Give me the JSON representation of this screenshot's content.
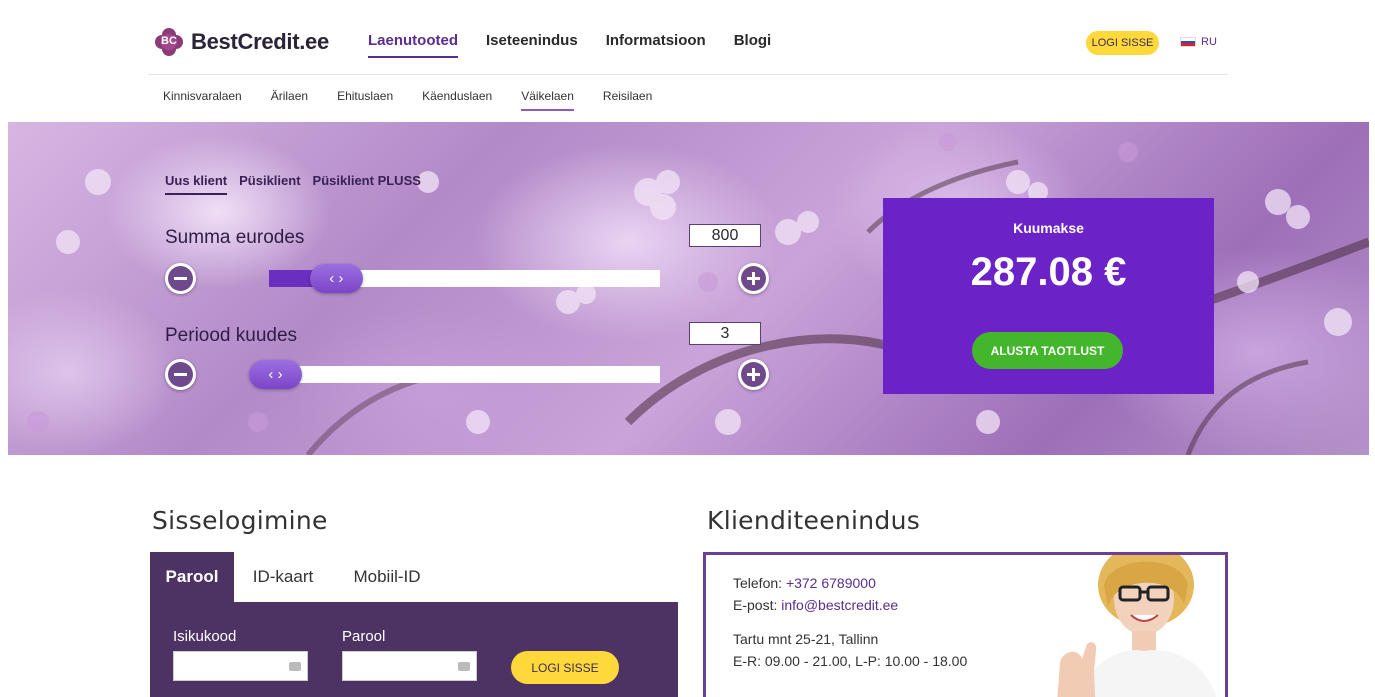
{
  "header": {
    "logo_mark": "BC",
    "logo_text": "BestCredit.ee",
    "nav": [
      "Laenutooted",
      "Iseteenindus",
      "Informatsioon",
      "Blogi"
    ],
    "nav_active": "Laenutooted",
    "login_label": "LOGI SISSE",
    "lang_label": "RU"
  },
  "subnav": {
    "items": [
      "Kinnisvaralaen",
      "Ärilaen",
      "Ehituslaen",
      "Käenduslaen",
      "Väikelaen",
      "Reisilaen"
    ],
    "active": "Väikelaen"
  },
  "calculator": {
    "client_tabs": [
      "Uus klient",
      "Püsiklient",
      "Püsiklient PLUSS"
    ],
    "active_tab": "Uus klient",
    "amount_label": "Summa eurodes",
    "amount_value": "800",
    "amount_fraction": 0.11,
    "period_label": "Periood kuudes",
    "period_value": "3",
    "period_fraction": 0.0,
    "handle_glyph": "‹ ›"
  },
  "payment": {
    "title": "Kuumakse",
    "amount": "287.08 €",
    "apply_label": "ALUSTA TAOTLUST"
  },
  "login": {
    "title": "Sisselogimine",
    "tabs": [
      "Parool",
      "ID-kaart",
      "Mobiil-ID"
    ],
    "active_tab": "Parool",
    "id_label": "Isikukood",
    "id_value": "",
    "password_label": "Parool",
    "password_value": "",
    "submit_label": "LOGI SISSE"
  },
  "support": {
    "title": "Klienditeenindus",
    "phone_label": "Telefon: ",
    "phone": "+372 6789000",
    "email_label": "E-post: ",
    "email": "info@bestcredit.ee",
    "address": "Tartu mnt 25-21, Tallinn",
    "hours": "E-R: 09.00 - 21.00, L-P: 10.00 - 18.00"
  },
  "colors": {
    "brand_purple": "#5b2d8e",
    "payment_bg": "#6b23c8",
    "login_panel": "#4d3364",
    "accent_yellow": "#ffd83a",
    "cta_green": "#44b62c"
  },
  "icons": [
    "minus-icon",
    "plus-icon",
    "slider-handle-icon",
    "flag-ru-icon",
    "keyboard-icon"
  ]
}
